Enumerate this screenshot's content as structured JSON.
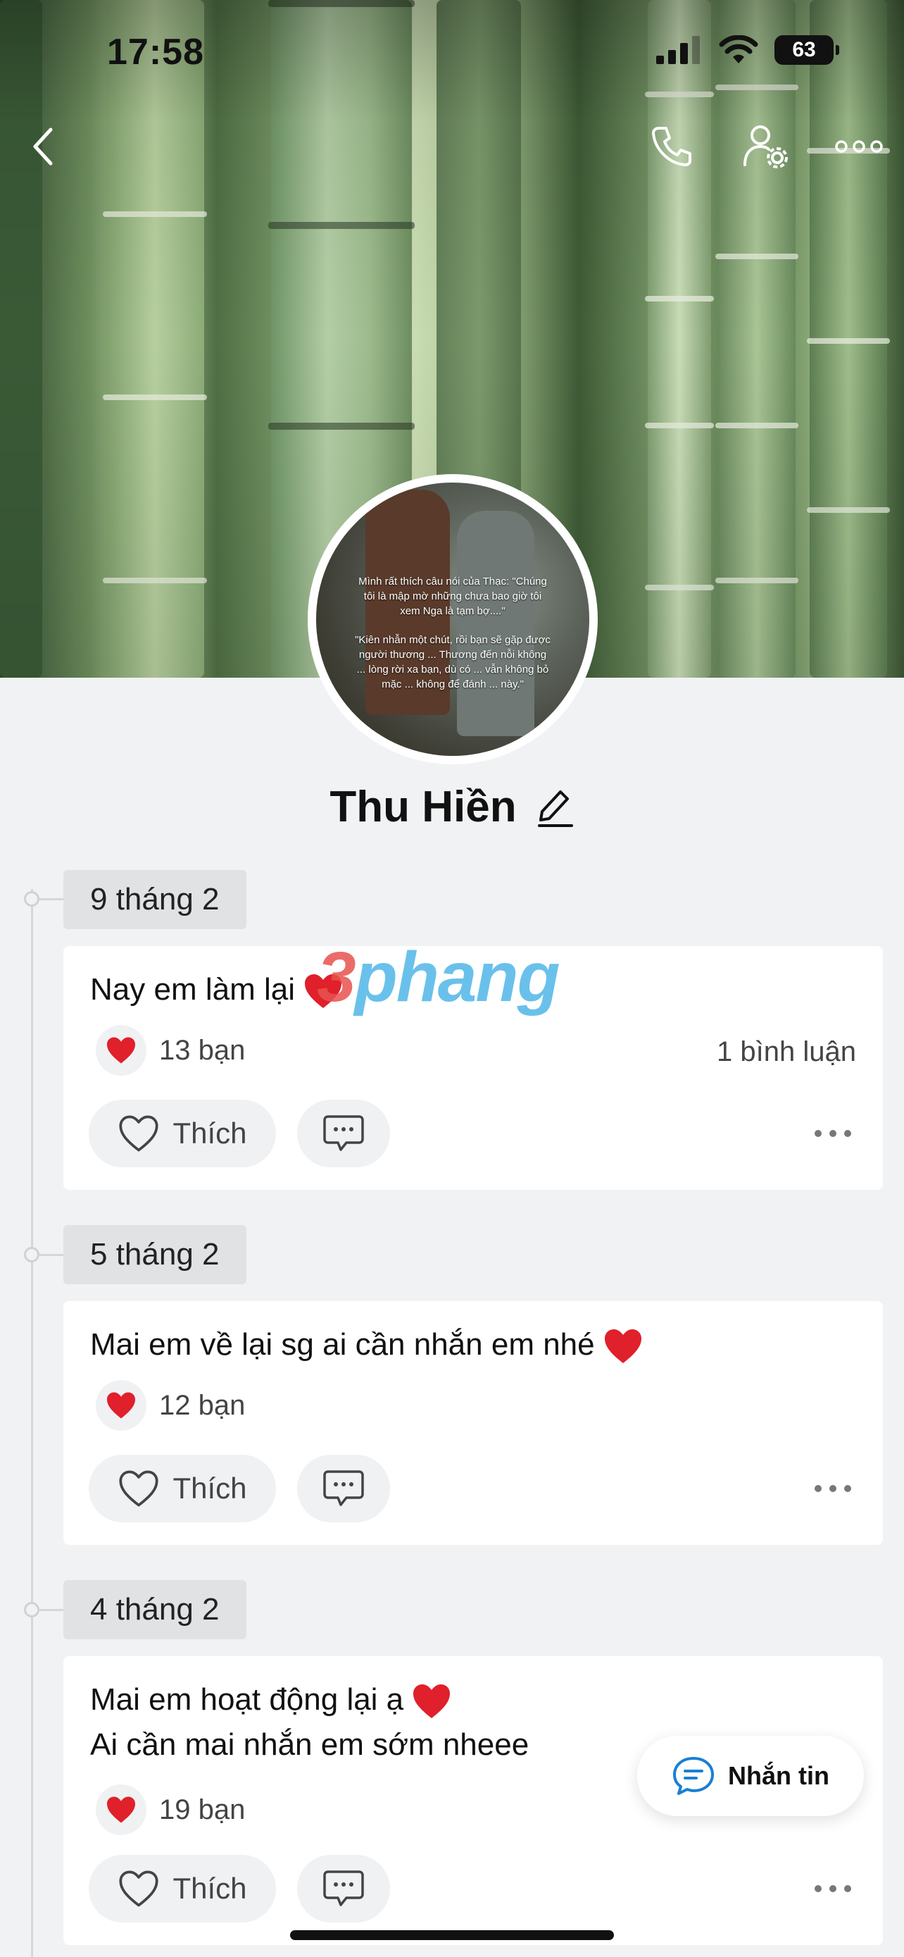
{
  "status_bar": {
    "time": "17:58",
    "battery": "63"
  },
  "profile": {
    "name": "Thu Hiền"
  },
  "avatar_caption": {
    "line1": "Mình rất thích câu nói của Thạc: \"Chúng tôi là mập mờ những chưa bao giờ tôi xem Nga là tạm bợ....\"",
    "line2": "\"Kiên nhẫn một chút, rồi bạn sẽ gặp được người thương ... Thương đến nỗi không ... lòng rời xa bạn, dù có ... vẫn không bỏ mặc ... không để đánh ... này.\""
  },
  "watermark": {
    "digit": "3",
    "text": "phang"
  },
  "posts": [
    {
      "date": "9 tháng 2",
      "text": "Nay em làm lại",
      "reactions": "13 bạn",
      "comments": "1 bình luận",
      "like_label": "Thích"
    },
    {
      "date": "5 tháng 2",
      "text": "Mai em về lại sg ai cần nhắn em nhé",
      "reactions": "12 bạn",
      "comments": "",
      "like_label": "Thích"
    },
    {
      "date": "4 tháng 2",
      "text": "Mai em hoạt động lại ạ",
      "text2": "Ai cần mai nhắn em sớm nheee",
      "reactions": "19 bạn",
      "comments": "",
      "like_label": "Thích"
    }
  ],
  "fab": {
    "label": "Nhắn tin"
  },
  "colors": {
    "heart": "#e0202b",
    "accent": "#1a7fd4",
    "watermark_blue": "#4fb7e8"
  },
  "icons": [
    "back-icon",
    "phone-icon",
    "user-settings-icon",
    "more-icon",
    "edit-pencil-icon",
    "heart-outline-icon",
    "comment-icon",
    "chat-icon"
  ]
}
